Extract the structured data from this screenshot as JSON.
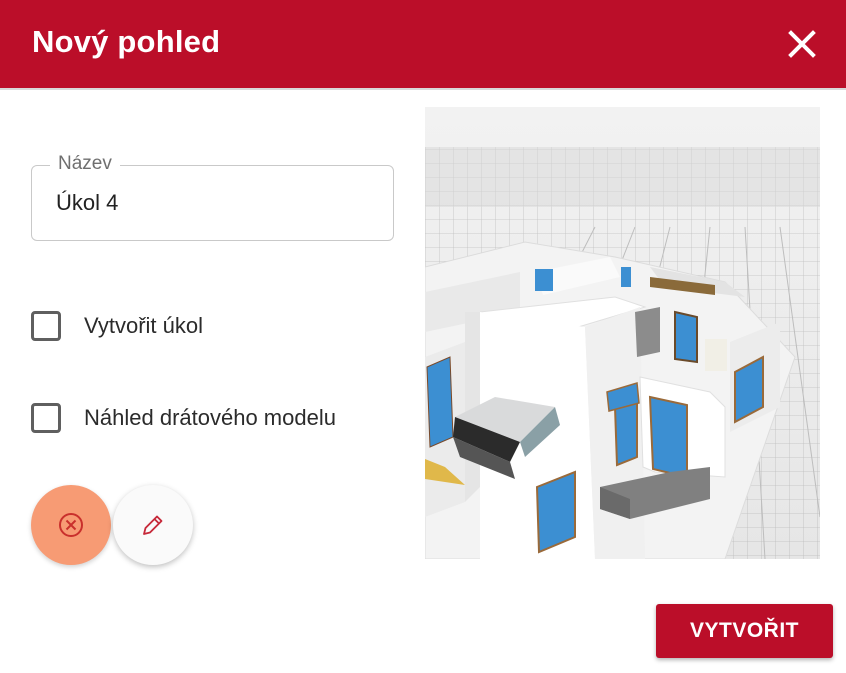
{
  "dialog": {
    "title": "Nový pohled",
    "close_icon": "close-icon"
  },
  "form": {
    "name_label": "Název",
    "name_value": "Úkol 4",
    "checkbox_create_task": {
      "label": "Vytvořit úkol",
      "checked": false
    },
    "checkbox_wireframe": {
      "label": "Náhled drátového modelu",
      "checked": false
    }
  },
  "actions": {
    "cancel_icon": "circle-x-icon",
    "edit_icon": "pencil-icon",
    "submit_label": "VYTVOŘIT"
  },
  "colors": {
    "brand": "#bb0e29",
    "cancel_button": "#f79b74"
  }
}
